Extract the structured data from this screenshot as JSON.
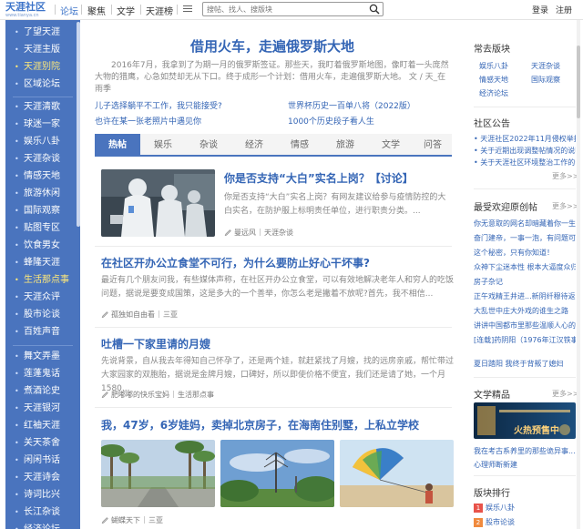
{
  "header": {
    "logo_main": "天涯社区",
    "logo_sub": "www.tianya.cn",
    "nav": [
      "论坛",
      "聚焦",
      "文学",
      "天涯榜"
    ],
    "search_placeholder": "搜帖、找人、搜版块",
    "login": "登录",
    "register": "注册"
  },
  "sidebar": {
    "items": [
      {
        "label": "了望天涯"
      },
      {
        "label": "天涯主版"
      },
      {
        "label": "天涯别院"
      },
      {
        "label": "区域论坛"
      },
      {
        "label": "天涯清歌"
      },
      {
        "label": "球迷一家"
      },
      {
        "label": "娱乐八卦"
      },
      {
        "label": "天涯杂谈"
      },
      {
        "label": "情感天地"
      },
      {
        "label": "旅游休闲"
      },
      {
        "label": "国际观察"
      },
      {
        "label": "贴图专区"
      },
      {
        "label": "饮食男女"
      },
      {
        "label": "蜂隆天涯"
      },
      {
        "label": "生活那点事"
      },
      {
        "label": "天涯众评"
      },
      {
        "label": "股市论谈"
      },
      {
        "label": "百姓声音"
      },
      {
        "label": "舞文弄墨"
      },
      {
        "label": "莲蓬鬼话"
      },
      {
        "label": "煮酒论史"
      },
      {
        "label": "天涯银河"
      },
      {
        "label": "红袖天涯"
      },
      {
        "label": "关天茶舍"
      },
      {
        "label": "闲闲书话"
      },
      {
        "label": "天涯诗会"
      },
      {
        "label": "诗词比兴"
      },
      {
        "label": "长江杂谈"
      },
      {
        "label": "经济论坛"
      }
    ]
  },
  "hero": {
    "title": "借用火车，走遍俄罗斯大地",
    "desc": "2016年7月，我拿到了为期一月的俄罗斯签证。那些天，我盯着俄罗斯地图，像盯着一头庞然大物的猎鹰，心急如焚却无从下口。终于成形一个计划：借用火车，走遍俄罗斯大地。 文 / 天_在雨季"
  },
  "quick_links": [
    "儿子选择躺平不工作，我只能接受?",
    "世界杯历史一百单八将（2022版）",
    "也许在某一张老照片中遇见你",
    "1000个历史段子看人生"
  ],
  "tabs": [
    "热帖",
    "娱乐",
    "杂谈",
    "经济",
    "情感",
    "旅游",
    "文学",
    "问答"
  ],
  "articles": [
    {
      "title": "你是否支持“大白”实名上岗？【讨论】",
      "body": "你是否支持“大白”实名上岗？有网友建议给参与疫情防控的大白实名，在防护服上标明责任单位，进行职责分类。...",
      "author": "曼远风",
      "board": "天涯杂谈"
    },
    {
      "title": "在社区开办公立食堂不可行，为什么要防止好心干坏事?",
      "body": "最近有几个朋友问我，有些媒体声称，在社区开办公立食堂，可以有效地解决老年人和穷人的吃饭问题，据说是要变成国策，这是多大的一个善举，你怎么老是撇着不放呢?首先，我不相信...",
      "author": "孤独如自由看",
      "board": "三亚"
    },
    {
      "title": "吐槽一下家里请的月嫂",
      "body": "先说背景，自从我去年得知自己怀孕了，还是两个娃，就赶紧找了月嫂，找的远房亲戚，帮忙带过大家园家的双胞胎，据说是金牌月嫂，口碑好，所以即使价格不便宜，我们还是请了她，一个月1580...",
      "author": "肥嘟嘟的快乐宝妈",
      "board": "生活那点事"
    },
    {
      "title": "我，47岁，6岁娃妈，卖掉北京房子，在海南住别墅，上私立学校",
      "author": "蝴蝶天下",
      "board": "三亚"
    }
  ],
  "right": {
    "common_title": "常去版块",
    "common_links": [
      "娱乐八卦",
      "天涯杂谈",
      "情感天地",
      "国际观察",
      "经济论坛"
    ],
    "notice_title": "社区公告",
    "notices": [
      "天涯社区2022年11月侵权举报",
      "关于近期出现调整帖情况的说明",
      "关于天涯社区环境整治工作的公告"
    ],
    "more": "更多>>",
    "welcome_title": "最受欢迎原创帖",
    "welcome_list": [
      "你无意取的网名却暗藏着你一生的...",
      "奋门建帝，一事一泡，有问题可...",
      "这个秘密，只有你知道！",
      "众神下尘迷本性 根本大逼度众归",
      "房子杂记",
      "正午戏精王井进...新阴纤穆待返...",
      "大乱世中庄大外戏的谁生之路",
      "讲讲中国都市里那些温顺人心的...",
      "[连载]药阴阳（1976年江汉铁事）",
      "夏日踏阳 我终于背叛了媳妇"
    ],
    "lit_title": "文学精品",
    "banner_text": "火热预售中",
    "lit_links": [
      "我在考古系养里的那些诡异事...",
      "心理师断新建"
    ],
    "rank_title": "版块排行",
    "ranks": [
      {
        "num": "1",
        "label": "娱乐八卦"
      },
      {
        "num": "2",
        "label": "股市论谈"
      }
    ],
    "colors": {
      "rank1": "#e8534a",
      "rank2": "#f08a3e"
    }
  },
  "colors": {
    "accent": "#3465b5",
    "sidebar": "#4a74be",
    "highlight": "#ffe97a"
  }
}
